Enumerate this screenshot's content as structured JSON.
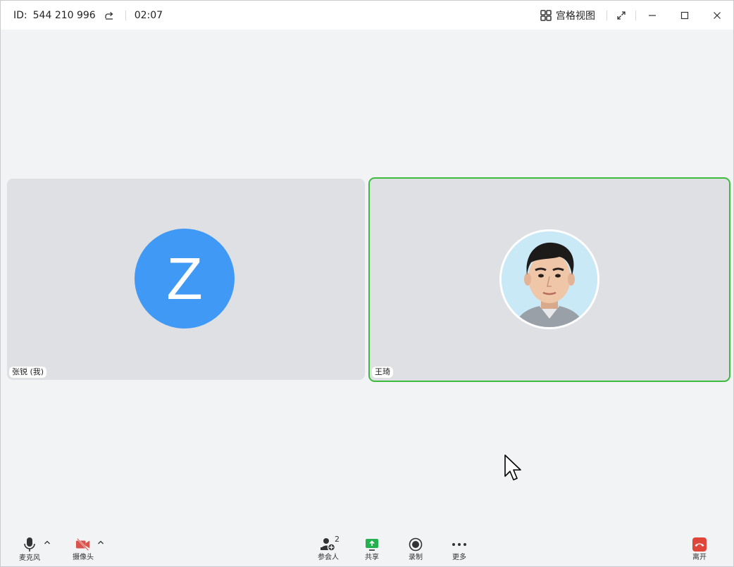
{
  "titlebar": {
    "id_label": "ID:",
    "meeting_id": "544 210 996",
    "timer": "02:07",
    "view_label": "宫格视图"
  },
  "participants": [
    {
      "name": "张锐 (我)",
      "initial": "Z",
      "avatar_color": "#3f99f5"
    },
    {
      "name": "王琦",
      "active_speaker_color": "#3dbb3d"
    }
  ],
  "toolbar": {
    "mic_label": "麦克风",
    "camera_label": "摄像头",
    "participants_label": "参会人",
    "participants_count": "2",
    "share_label": "共享",
    "record_label": "录制",
    "more_label": "更多",
    "leave_label": "离开"
  },
  "colors": {
    "accent": "#3f99f5",
    "speaking_border": "#3dbb3d",
    "share_green": "#22b14c",
    "leave_red": "#e0453a",
    "camera_off_red": "#d9534f"
  }
}
